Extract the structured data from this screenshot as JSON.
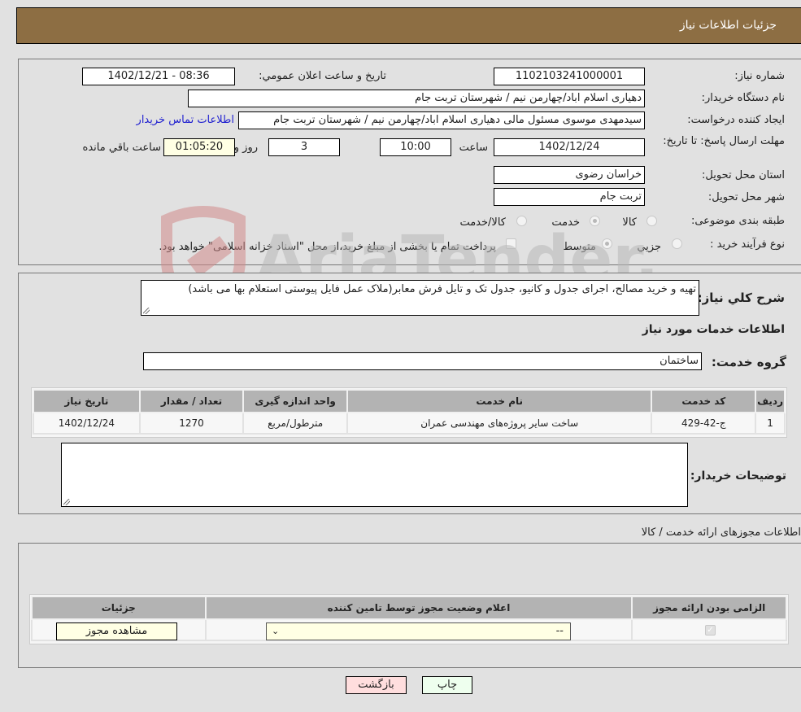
{
  "header": {
    "title": "جزئیات اطلاعات نیاز"
  },
  "details": {
    "need_number_label": "شماره نیاز:",
    "need_number": "1102103241000001",
    "announce_label": "تاریخ و ساعت اعلان عمومي:",
    "announce_value": "1402/12/21 - 08:36",
    "buyer_org_label": "نام دستگاه خریدار:",
    "buyer_org": "دهیاری اسلام اباد/چهارمن نیم /  شهرستان تربت جام",
    "requester_label": "ایجاد کننده درخواست:",
    "requester": "سیدمهدی موسوی مسئول مالی دهیاری اسلام اباد/چهارمن نیم /  شهرستان تربت جام",
    "contact_link": "اطلاعات تماس خریدار",
    "deadline_label": "مهلت ارسال پاسخ: تا تاریخ:",
    "deadline_date": "1402/12/24",
    "time_label": "ساعت",
    "deadline_time": "10:00",
    "days": "3",
    "days_label": "روز و",
    "remaining": "01:05:20",
    "remaining_label": "ساعت باقي مانده",
    "province_label": "استان محل تحویل:",
    "province": "خراسان رضوی",
    "city_label": "شهر محل تحویل:",
    "city": "تربت جام",
    "category_label": "طبقه بندی موضوعی:",
    "category_options": [
      "کالا",
      "خدمت",
      "کالا/خدمت"
    ],
    "category_selected": "خدمت",
    "process_label": "نوع فرآیند خرید :",
    "process_options": [
      "جزيي",
      "متوسط"
    ],
    "process_selected": "متوسط",
    "treasury_note": "پرداخت تمام یا بخشی از مبلغ خرید،از محل \"اسناد خزانه اسلامی\" خواهد بود."
  },
  "description": {
    "label": "شرح کلي نیاز:",
    "text": "تهیه و خرید مصالح، اجرای جدول و کانیو، جدول تک و تایل فرش معابر(ملاک عمل فایل پیوستی استعلام بها می باشد)",
    "services_heading": "اطلاعات خدمات مورد نیاز",
    "service_group_label": "گروه خدمت:",
    "service_group": "ساختمان"
  },
  "services_table": {
    "headers": [
      "ردیف",
      "کد خدمت",
      "نام خدمت",
      "واحد اندازه گیری",
      "تعداد / مقدار",
      "تاریخ نیاز"
    ],
    "rows": [
      [
        "1",
        "ج-42-429",
        "ساخت سایر پروژه‌های مهندسی عمران",
        "مترطول/مربع",
        "1270",
        "1402/12/24"
      ]
    ]
  },
  "buyer_notes": {
    "label": "توضیحات خریدار:",
    "value": ""
  },
  "permits": {
    "heading": "اطلاعات مجوزهای ارائه خدمت / کالا",
    "headers": [
      "الزامی بودن ارائه مجوز",
      "اعلام وضعیت مجوز توسط تامین کننده",
      "جزئیات"
    ],
    "row": {
      "required_checked": true,
      "status_value": "--",
      "details_button": "مشاهده مجوز"
    }
  },
  "footer": {
    "print_button": "چاپ",
    "back_button": "بازگشت"
  },
  "watermark": {
    "text": "AriaTender.neT"
  }
}
